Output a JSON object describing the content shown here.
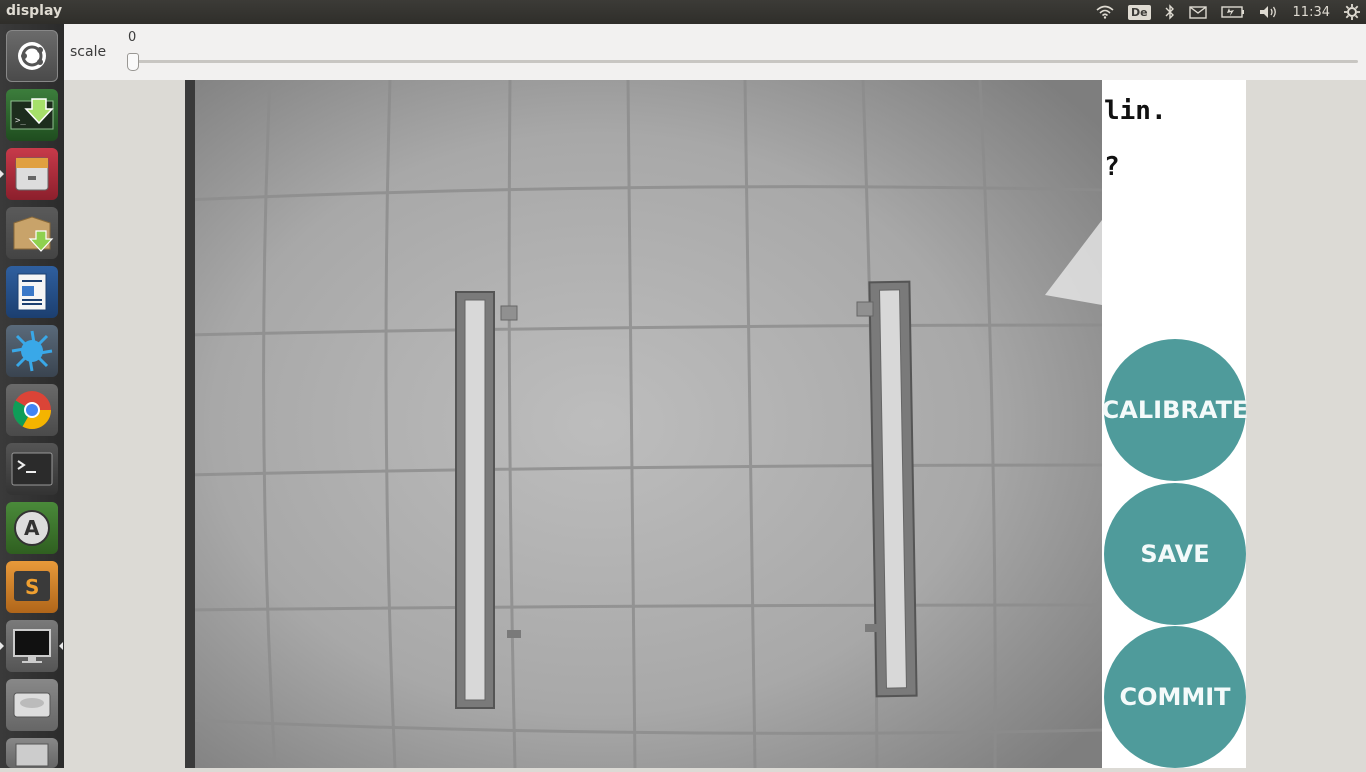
{
  "topbar": {
    "title": "display",
    "keyboard_layout": "De",
    "clock": "11:34",
    "icons": [
      "wifi-icon",
      "keyboard-layout-indicator",
      "bluetooth-icon",
      "mail-icon",
      "battery-icon",
      "volume-icon",
      "clock",
      "settings-gear-icon"
    ]
  },
  "launcher": {
    "items": [
      {
        "name": "ubuntu-dash-icon"
      },
      {
        "name": "installer-icon"
      },
      {
        "name": "file-manager-icon"
      },
      {
        "name": "archive-manager-icon"
      },
      {
        "name": "libreoffice-writer-icon"
      },
      {
        "name": "paint-splash-icon"
      },
      {
        "name": "chrome-icon"
      },
      {
        "name": "terminal-icon"
      },
      {
        "name": "software-updater-icon"
      },
      {
        "name": "sublime-text-icon"
      },
      {
        "name": "display-app-icon"
      },
      {
        "name": "disk-drive-icon"
      },
      {
        "name": "trash-icon"
      }
    ]
  },
  "toolbar": {
    "scale_label": "scale",
    "scale_value": "0",
    "scale_fraction": 0
  },
  "panel": {
    "line1": "lin.",
    "line2": "?",
    "calibrate_label": "CALIBRATE",
    "save_label": "SAVE",
    "commit_label": "COMMIT"
  },
  "colors": {
    "button_teal": "#4f9b9b",
    "topbar_bg": "#3c3b37",
    "launcher_bg": "#2f2f2f"
  }
}
